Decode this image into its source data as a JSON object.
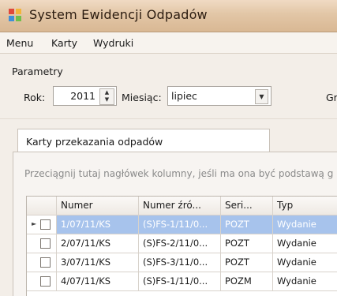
{
  "window": {
    "title": "System Ewidencji Odpadów",
    "icon": "app-icon"
  },
  "menu": [
    "Menu",
    "Karty",
    "Wydruki"
  ],
  "parameters": {
    "group_title": "Parametry",
    "year_label": "Rok:",
    "year_value": "2011",
    "month_label": "Miesiąc:",
    "month_value": "lipiec",
    "cut_label": "Gr"
  },
  "tab": {
    "label": "Karty przekazania odpadów"
  },
  "grid": {
    "group_hint": "Przeciągnij tutaj nagłówek kolumny, jeśli ma ona być podstawą g",
    "columns": [
      "Numer",
      "Numer źró...",
      "Seri...",
      "Typ"
    ],
    "rows": [
      {
        "selected": true,
        "numer": "1/07/11/KS",
        "zrodlo": "(S)FS-1/11/0...",
        "seria": "POZT",
        "typ": "Wydanie"
      },
      {
        "selected": false,
        "numer": "2/07/11/KS",
        "zrodlo": "(S)FS-2/11/0...",
        "seria": "POZT",
        "typ": "Wydanie"
      },
      {
        "selected": false,
        "numer": "3/07/11/KS",
        "zrodlo": "(S)FS-3/11/0...",
        "seria": "POZT",
        "typ": "Wydanie"
      },
      {
        "selected": false,
        "numer": "4/07/11/KS",
        "zrodlo": "(S)FS-1/11/0...",
        "seria": "POZM",
        "typ": "Wydanie"
      }
    ]
  },
  "colors": {
    "selection": "#a7c3ec",
    "titlebar": "#e2c6a6",
    "hint": "#8a8a8a"
  }
}
